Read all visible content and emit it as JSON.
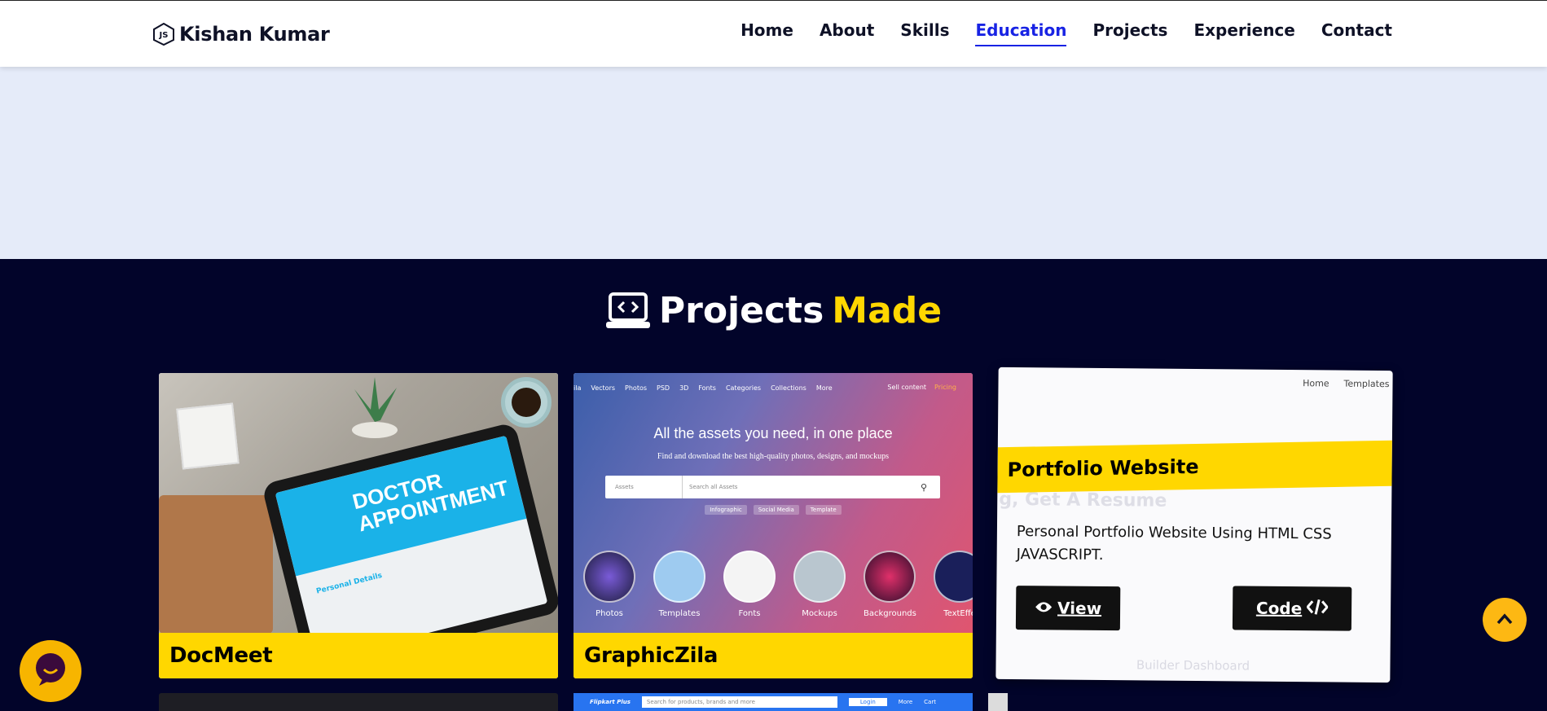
{
  "brand": {
    "name": "Kishan Kumar",
    "icon": "js-hexagon-icon"
  },
  "nav": {
    "items": [
      {
        "label": "Home"
      },
      {
        "label": "About"
      },
      {
        "label": "Skills"
      },
      {
        "label": "Education",
        "active": true
      },
      {
        "label": "Projects"
      },
      {
        "label": "Experience"
      },
      {
        "label": "Contact"
      }
    ],
    "active_color": "#1823e4"
  },
  "projects": {
    "heading": "Projects",
    "heading_accent": "Made",
    "heading_icon": "laptop-code-icon",
    "accent_color": "#ffd700",
    "background": "#02042a",
    "cards": [
      {
        "title": "DocMeet",
        "image_text_line1": "DOCTOR",
        "image_text_line2": "APPOINTMENT",
        "image_form_heading": "Personal Details"
      },
      {
        "title": "GraphicZila",
        "nav": [
          "ila",
          "Vectors",
          "Photos",
          "PSD",
          "3D",
          "Fonts",
          "Categories",
          "Collections",
          "More"
        ],
        "nav_right": [
          "Sell content",
          "Pricing"
        ],
        "headline": "All the assets you need, in one place",
        "subline": "Find and download the best high-quality photos, designs, and mockups",
        "search_scope": "Assets",
        "search_placeholder": "Search all Assets",
        "tags": [
          "Infographic",
          "Social Media",
          "Template"
        ],
        "categories": [
          "Photos",
          "Templates",
          "Fonts",
          "Mockups",
          "Backgrounds",
          "TextEffe"
        ]
      },
      {
        "title": "Portfolio Website",
        "description": "Personal Portfolio Website Using HTML CSS JAVASCRIPT.",
        "view_label": "View",
        "code_label": "Code",
        "ghost_nav": [
          "Home",
          "Templates"
        ],
        "ghost_text": "g, Get A Resume",
        "ghost_footer": "Builder Dashboard"
      }
    ],
    "peek_flipkart": {
      "logo": "Flipkart Plus",
      "search": "Search for products, brands and more",
      "login": "Login",
      "more": "More",
      "cart": "Cart"
    }
  },
  "floating": {
    "scroll_top_icon": "chevron-up-icon",
    "chat_icon": "chat-bubble-icon"
  }
}
